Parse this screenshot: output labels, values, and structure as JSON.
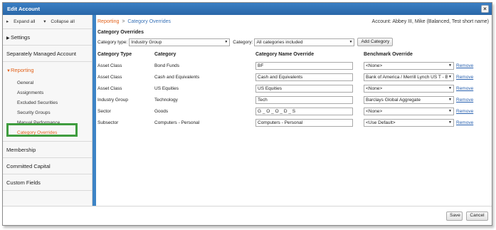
{
  "window": {
    "title": "Edit Account",
    "close_glyph": "×"
  },
  "sidebar": {
    "expand_all": "Expand all",
    "collapse_all": "Collapse all",
    "settings": "Settings",
    "sma": "Separately Managed Account",
    "reporting": "Reporting",
    "reporting_items": [
      "General",
      "Assignments",
      "Excluded Securities",
      "Security Groups",
      "Manual Performance",
      "Category Overrides"
    ],
    "membership": "Membership",
    "committed_capital": "Committed Capital",
    "custom_fields": "Custom Fields"
  },
  "breadcrumb": {
    "parent": "Reporting",
    "separator": ">",
    "current": "Category Overrides"
  },
  "account": "Account: Abbey III, Mike (Balanced, Test short name)",
  "section_title": "Category Overrides",
  "filters": {
    "category_type_label": "Category type:",
    "category_type_value": "Industry Group",
    "category_label": "Category:",
    "category_value": "All categories included",
    "add_button": "Add Category"
  },
  "table": {
    "headers": [
      "Category Type",
      "Category",
      "Category Name Override",
      "Benchmark Override"
    ],
    "remove_label": "Remove",
    "rows": [
      {
        "type": "Asset Class",
        "category": "Bond Funds",
        "override": "BF",
        "benchmark": "<None>"
      },
      {
        "type": "Asset Class",
        "category": "Cash and Equivalents",
        "override": "Cash and Equivalents",
        "benchmark": "Bank of America / Merrill Lynch US T - Bill"
      },
      {
        "type": "Asset Class",
        "category": "US Equities",
        "override": "US Equities",
        "benchmark": "<None>"
      },
      {
        "type": "Industry Group",
        "category": "Technology",
        "override": "Tech",
        "benchmark": "Barclays Global Aggregate"
      },
      {
        "type": "Sector",
        "category": "Goods",
        "override": "G _ O _ O _ D _ S",
        "benchmark": "<None>"
      },
      {
        "type": "Subsector",
        "category": "Computers - Personal",
        "override": "Computers - Personal",
        "benchmark": "<Use Default>"
      }
    ]
  },
  "footer": {
    "save": "Save",
    "cancel": "Cancel"
  },
  "colors": {
    "titlebar": "#2f71b6",
    "accent_orange": "#e2621b",
    "link_blue": "#2a62b0",
    "highlight_green": "#3f9d3f",
    "divider_blue": "#3d84c6"
  }
}
